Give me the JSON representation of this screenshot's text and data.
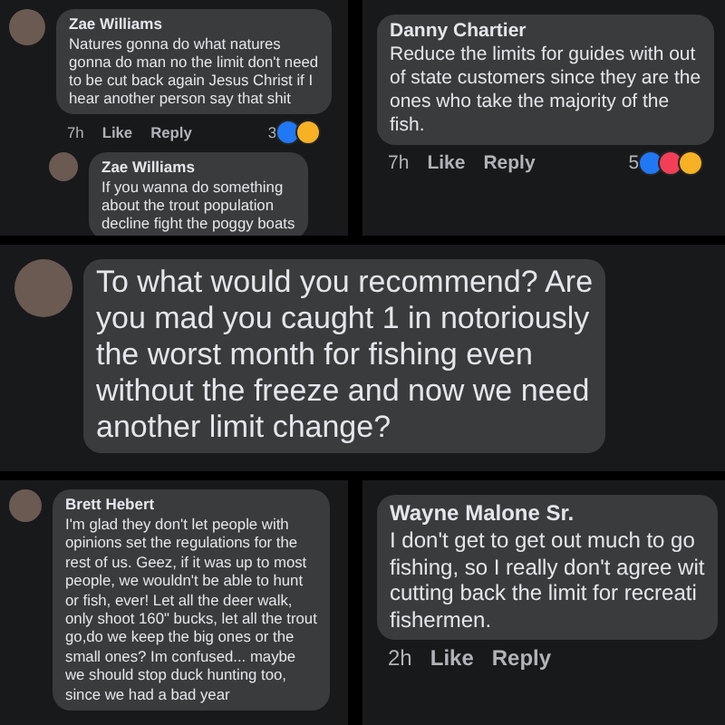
{
  "panels": [
    {
      "comments": [
        {
          "author": "Zae Williams",
          "lines": [
            "Natures gonna do what natures",
            "gonna do man no the limit don't need",
            "to be cut back again Jesus Christ if I",
            "hear another person say that shit"
          ],
          "meta": {
            "time": "7h",
            "like": "Like",
            "reply": "Reply",
            "count": "3",
            "reactions": [
              {
                "kind": "like"
              },
              {
                "kind": "haha"
              }
            ]
          },
          "is_reply": false
        },
        {
          "author": "Zae Williams",
          "lines": [
            "If you wanna do something",
            "about the trout population",
            "decline fight the poggy boats"
          ],
          "is_reply": true
        }
      ]
    },
    {
      "comments": [
        {
          "author": "Danny Chartier",
          "lines": [
            "Reduce the limits for guides with out",
            "of state customers since they are the",
            "ones who take the majority of the",
            "fish."
          ],
          "meta": {
            "time": "7h",
            "like": "Like",
            "reply": "Reply",
            "count": "5",
            "reactions": [
              {
                "kind": "like"
              },
              {
                "kind": "love"
              },
              {
                "kind": "haha"
              }
            ]
          },
          "is_reply": false
        }
      ]
    },
    {
      "comments": [
        {
          "lines": [
            "To what would you recommend? Are",
            "you mad you caught 1 in notoriously",
            "the worst month for fishing even",
            "without the freeze and now we need",
            "another limit change?"
          ],
          "is_reply": false
        }
      ]
    },
    {
      "comments": [
        {
          "author": "Brett Hebert",
          "lines": [
            "I'm glad they don't let people with",
            "opinions set the regulations for the",
            "rest of us. Geez, if it was up to most",
            "people,  we wouldn't be able to hunt",
            "or fish, ever! Let all the deer walk,",
            "only shoot 160\" bucks, let all the trout",
            "go,do we keep the big ones or the",
            "small ones? Im confused... maybe",
            "we should stop duck hunting too,",
            "since we had a bad year"
          ],
          "is_reply": false
        }
      ]
    },
    {
      "comments": [
        {
          "author": "Wayne Malone Sr.",
          "lines": [
            "I don't get to get out much to go",
            "fishing, so I really don't agree wit",
            "cutting back the limit for recreati",
            "fishermen."
          ],
          "meta": {
            "time": "2h",
            "like": "Like",
            "reply": "Reply"
          },
          "is_reply": false
        }
      ]
    }
  ]
}
